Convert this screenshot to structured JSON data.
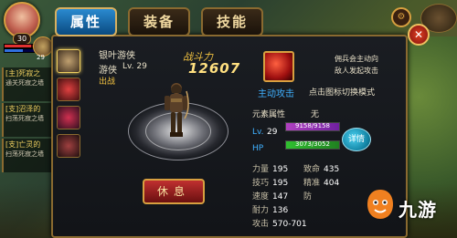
{
  "tabs": [
    {
      "label": "属性",
      "active": true
    },
    {
      "label": "装备",
      "active": false
    },
    {
      "label": "技能",
      "active": false
    }
  ],
  "hero": {
    "level": "30",
    "hp_fraction": 0.85,
    "mp_fraction": 0.6,
    "pet_level": "29"
  },
  "quests": [
    {
      "title": "[主]死寂之",
      "desc": "通关死寂之墙"
    },
    {
      "title": "[支]沼泽的",
      "desc": "扫荡死寂之墙"
    },
    {
      "title": "[支]亡灵的",
      "desc": "扫荡死寂之墙"
    }
  ],
  "character": {
    "name": "银叶游侠",
    "class": "游侠",
    "level_label": "Lv. 29",
    "deployed": "出战",
    "power_label": "战斗力",
    "power_value": "12607"
  },
  "skill": {
    "label": "主动攻击",
    "desc_line1": "佣兵会主动向",
    "desc_line2": "敌人发起攻击",
    "hint": "点击图标切换模式"
  },
  "element": {
    "label": "元素属性",
    "value": "无"
  },
  "level_bar": {
    "label": "Lv.",
    "value": "29",
    "text": "9158/9158",
    "fraction": 1.0
  },
  "hp_bar": {
    "label": "HP",
    "text": "3073/3052",
    "fraction": 1.0
  },
  "detail_button": "详情",
  "rest_button": "休息",
  "stats": [
    {
      "label": "力量",
      "value": "195"
    },
    {
      "label": "致命",
      "value": "435"
    },
    {
      "label": "技巧",
      "value": "195"
    },
    {
      "label": "精准",
      "value": "404"
    },
    {
      "label": "速度",
      "value": "147"
    },
    {
      "label": "防",
      "value": ""
    },
    {
      "label": "耐力",
      "value": "136"
    },
    {
      "label": "",
      "value": ""
    },
    {
      "label": "攻击",
      "value": "570-701"
    }
  ],
  "watermark": "九游"
}
